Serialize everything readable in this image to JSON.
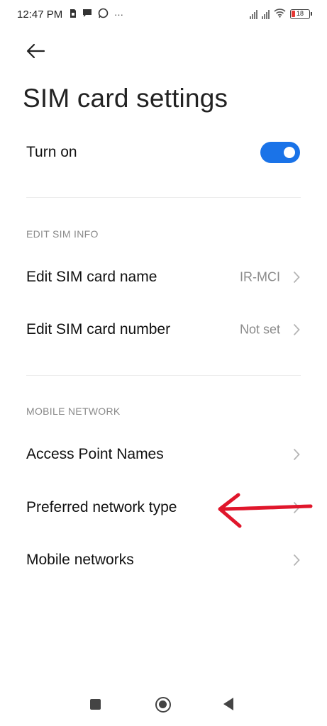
{
  "status_bar": {
    "time": "12:47 PM",
    "left_icons": [
      "sim-card-icon",
      "chat-bubble-icon",
      "whatsapp-icon",
      "more-dots-icon"
    ],
    "more_glyph": "···",
    "battery_level": "18",
    "right_icons": [
      "signal-sim1-icon",
      "signal-sim2-icon",
      "wifi-icon",
      "battery-icon"
    ]
  },
  "header": {
    "back_icon": "arrow-left-icon",
    "title": "SIM card settings"
  },
  "toggle_row": {
    "label": "Turn on",
    "state": "on",
    "accent_color": "#1a73e8"
  },
  "sections": {
    "edit_sim_info": {
      "title": "EDIT SIM INFO",
      "items": [
        {
          "label": "Edit SIM card name",
          "value": "IR-MCI"
        },
        {
          "label": "Edit SIM card number",
          "value": "Not set"
        }
      ]
    },
    "mobile_network": {
      "title": "MOBILE NETWORK",
      "items": [
        {
          "label": "Access Point Names",
          "value": ""
        },
        {
          "label": "Preferred network type",
          "value": ""
        },
        {
          "label": "Mobile networks",
          "value": ""
        }
      ]
    }
  },
  "annotation": {
    "type": "red-arrow-pointing-left",
    "color": "#e0162b",
    "target": "Preferred network type"
  },
  "nav_bar": {
    "icons": [
      "recents-square-icon",
      "home-circle-icon",
      "back-triangle-icon"
    ]
  }
}
